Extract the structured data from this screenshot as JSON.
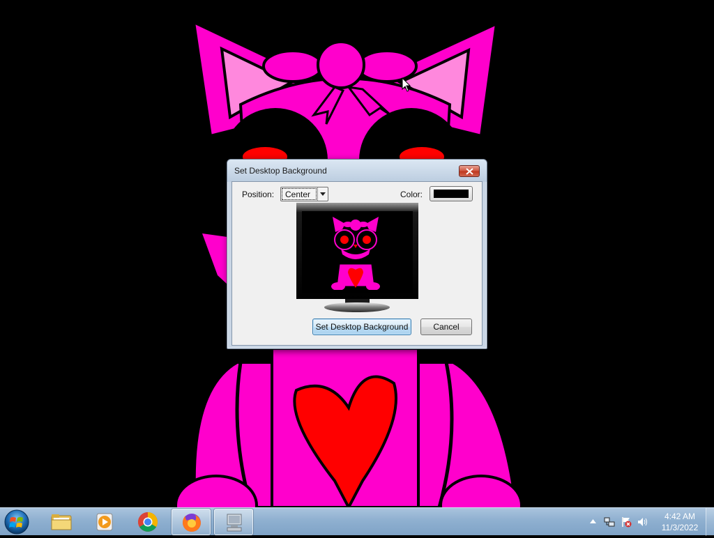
{
  "desktop": {
    "wallpaper_colors": {
      "pink": "#ff00cc",
      "light_pink": "#ff88dd",
      "red": "#ff0000",
      "black": "#000000"
    }
  },
  "dialog": {
    "title": "Set Desktop Background",
    "position_label": "Position:",
    "position_value": "Center",
    "color_label": "Color:",
    "color_value": "#000000",
    "set_button_label": "Set Desktop Background",
    "cancel_button_label": "Cancel"
  },
  "taskbar": {
    "items": [
      {
        "name": "start-button",
        "icon": "windows-logo-icon"
      },
      {
        "name": "file-explorer",
        "icon": "folder-icon"
      },
      {
        "name": "media-player",
        "icon": "media-player-icon"
      },
      {
        "name": "chrome",
        "icon": "chrome-icon"
      },
      {
        "name": "firefox",
        "icon": "firefox-icon",
        "open": true
      },
      {
        "name": "set-background-app",
        "icon": "computer-icon",
        "open": true
      }
    ],
    "tray_icons": [
      "show-hidden-icons-arrow",
      "network-icon",
      "action-center-icon",
      "volume-icon"
    ],
    "clock_time": "4:42 AM",
    "clock_date": "11/3/2022"
  }
}
